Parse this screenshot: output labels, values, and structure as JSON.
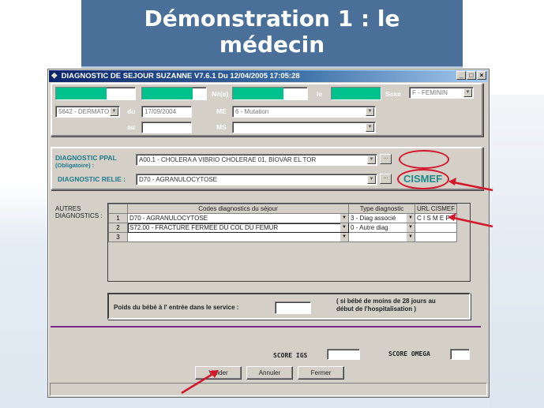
{
  "slide": {
    "title_line1": "Démonstration 1 : le",
    "title_line2": "médecin"
  },
  "window": {
    "title": "DIAGNOSTIC DE SEJOUR  SUZANNE  V7.6.1 Du 12/04/2005 17:05:28",
    "controls": {
      "minimize": "_",
      "maximize": "□",
      "close": "×"
    }
  },
  "patient": {
    "labels": {
      "born": "Né(e)",
      "le": "le",
      "sexe": "Sexe",
      "du": "du",
      "au": "au",
      "me": "ME",
      "ms": "MS"
    },
    "sexe_value": "F - FEMININ",
    "unit_value": "5642 - DERMATO.",
    "date_du": "17/09/2004",
    "date_au": "",
    "me_value": "6 - Mutation",
    "ms_value": ""
  },
  "diagnostics": {
    "ppal_label": "DIAGNOSTIC PPAL",
    "ppal_sublabel": "(Obligatoire) :",
    "ppal_value": "A00.1 - CHOLERA A VIBRIO CHOLERAE 01, BIOVAR EL TOR",
    "relie_label": "DIAGNOSTIC RELIE :",
    "relie_value": "D70 - AGRANULOCYTOSE",
    "ellipsis": "...",
    "cismef_annotation": "CISMEF"
  },
  "autres": {
    "label_line1": "AUTRES",
    "label_line2": "DIAGNOSTICS :",
    "columns": [
      "",
      "Codes diagnostics du séjour",
      "Type diagnostic",
      "URL CISMEF"
    ],
    "rows": [
      {
        "num": "1",
        "code": "D70 - AGRANULOCYTOSE",
        "type": "3 - Diag associé",
        "url": "C I S M E F"
      },
      {
        "num": "2",
        "code": "S72.00 - FRACTURE FERMEE DU COL DU FEMUR",
        "type": "0 - Autre diag",
        "url": ""
      },
      {
        "num": "3",
        "code": "",
        "type": "",
        "url": ""
      }
    ]
  },
  "bebe": {
    "label": "Poids du bébé  à  l' entrée  dans  le  service :",
    "value": "",
    "note_line1": "( si bébé de moins de 28 jours au",
    "note_line2": "début de l'hospitalisation )"
  },
  "scores": {
    "igs_label": "SCORE  IGS",
    "igs_value": "",
    "omega_label": "SCORE  OMEGA",
    "omega_value": ""
  },
  "buttons": {
    "valider": "Valider",
    "annuler": "Annuler",
    "fermer": "Fermer"
  },
  "colors": {
    "slide_header": "#4a7099",
    "masked_field": "#00c08b",
    "annotation_red": "#d3162a",
    "cismef_teal": "#1e8a8a",
    "separator_purple": "#7a2a8a"
  }
}
